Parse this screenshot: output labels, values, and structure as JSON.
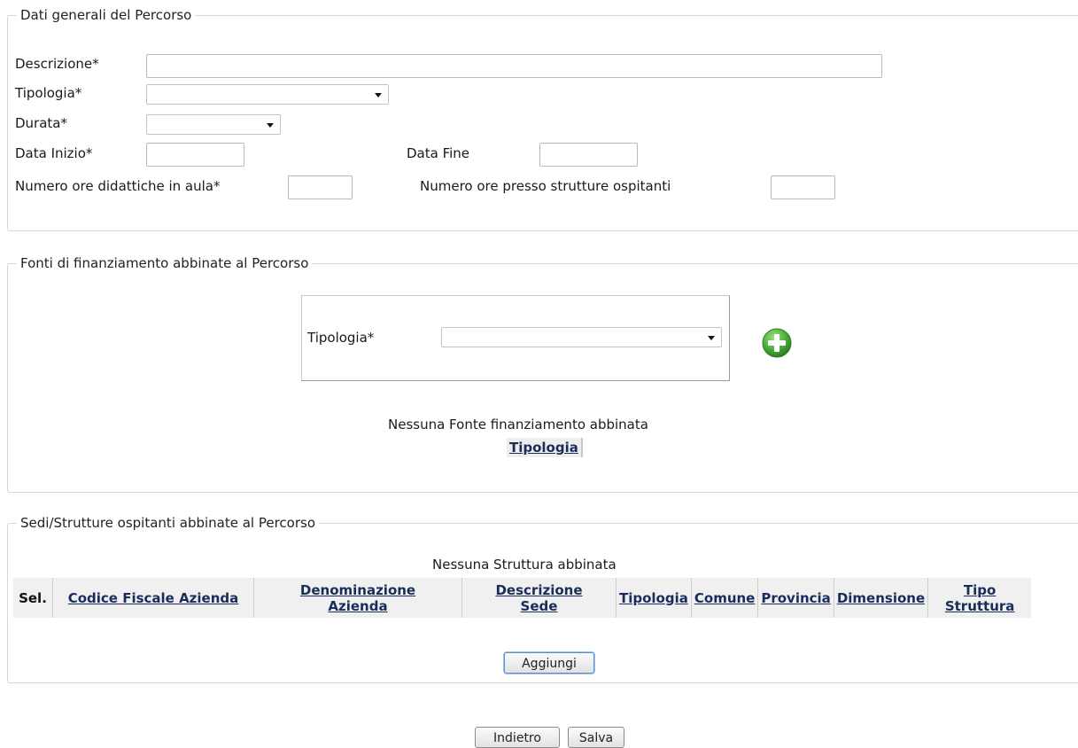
{
  "section_general": {
    "legend": "Dati generali del Percorso",
    "descrizione_label": "Descrizione*",
    "descrizione_value": "",
    "tipologia_label": "Tipologia*",
    "tipologia_value": "",
    "durata_label": "Durata*",
    "durata_value": "",
    "data_inizio_label": "Data Inizio*",
    "data_inizio_value": "",
    "data_fine_label": "Data Fine",
    "data_fine_value": "",
    "ore_aula_label": "Numero ore didattiche in aula*",
    "ore_aula_value": "",
    "ore_strutture_label": "Numero ore presso strutture ospitanti",
    "ore_strutture_value": ""
  },
  "section_funding": {
    "legend": "Fonti di finanziamento abbinate al Percorso",
    "tipologia_label": "Tipologia*",
    "tipologia_value": "",
    "add_icon": "plus-circle-icon",
    "empty_message": "Nessuna Fonte finanziamento abbinata",
    "column_header": "Tipologia"
  },
  "section_structures": {
    "legend": "Sedi/Strutture ospitanti abbinate al Percorso",
    "empty_message": "Nessuna Struttura abbinata",
    "columns": {
      "sel": "Sel.",
      "codice_fiscale": "Codice Fiscale Azienda",
      "denominazione_1": "Denominazione",
      "denominazione_2": "Azienda",
      "descrizione_1": "Descrizione",
      "descrizione_2": "Sede",
      "tipologia": "Tipologia",
      "comune": "Comune",
      "provincia": "Provincia",
      "dimensione": "Dimensione",
      "tipo_1": "Tipo",
      "tipo_2": "Struttura"
    },
    "add_button": "Aggiungi"
  },
  "footer": {
    "back_button": "Indietro",
    "save_button": "Salva"
  },
  "colors": {
    "add_icon_green": "#4caf3a",
    "header_link": "#1a2c5a",
    "border": "#d8d8d8"
  }
}
